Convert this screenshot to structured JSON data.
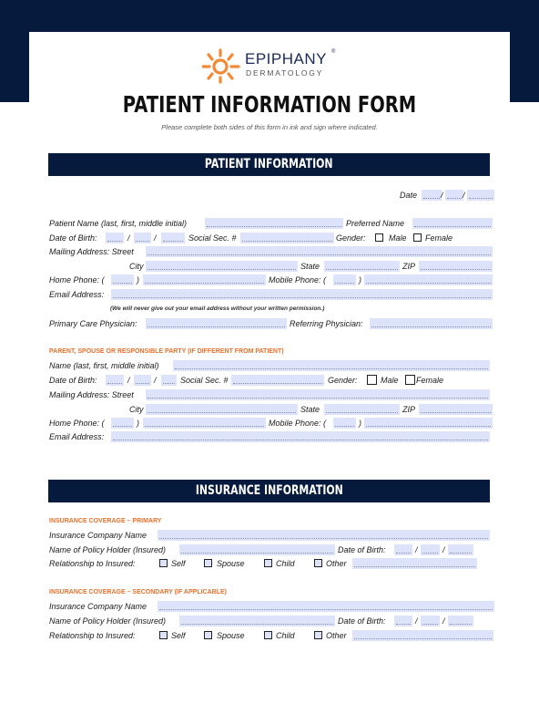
{
  "header": {
    "logo_name": "EPIPHANY",
    "logo_registered": "®",
    "logo_subtitle": "DERMATOLOGY",
    "title": "PATIENT INFORMATION FORM",
    "subtitle": "Please complete both sides of this form in ink and sign where indicated."
  },
  "colors": {
    "navy": "#061a3d",
    "accent_orange": "#e8702a",
    "field_fill": "#dde3fb"
  },
  "patient_section": {
    "title": "PATIENT INFORMATION",
    "date_label": "Date",
    "name_label": "Patient Name (last, first, middle initial)",
    "preferred_name_label": "Preferred Name",
    "dob_label": "Date of Birth:",
    "slash": "/",
    "ssn_label": "Social Sec. #",
    "gender_label": "Gender:",
    "male_label": "Male",
    "female_label": "Female",
    "street_label": "Mailing Address: Street",
    "city_label": "City",
    "state_label": "State",
    "zip_label": "ZIP",
    "home_phone_label": "Home Phone: (",
    "paren_close": ")",
    "mobile_phone_label": "Mobile Phone: (",
    "email_label": "Email Address:",
    "email_note": "(We will never give out your email address without your written permission.)",
    "pcp_label": "Primary Care Physician:",
    "referring_label": "Referring Physician:"
  },
  "responsible_party": {
    "heading": "PARENT, SPOUSE OR RESPONSIBLE PARTY (IF DIFFERENT FROM PATIENT)",
    "name_label": "Name (last, first, middle initial)",
    "dob_label": "Date of Birth:",
    "ssn_label": "Social Sec. #",
    "gender_label": "Gender:",
    "male_label": "Male",
    "female_label": "Female",
    "street_label": "Mailing Address: Street",
    "city_label": "City",
    "state_label": "State",
    "zip_label": "ZIP",
    "home_phone_label": "Home Phone: (",
    "mobile_phone_label": "Mobile Phone: (",
    "email_label": "Email Address:"
  },
  "insurance_section": {
    "title": "INSURANCE INFORMATION",
    "primary": {
      "heading": "INSURANCE COVERAGE – PRIMARY",
      "company_label": "Insurance Company Name",
      "holder_label": "Name of Policy Holder (Insured)",
      "dob_label": "Date of Birth:",
      "relationship_label": "Relationship to Insured:",
      "options": [
        "Self",
        "Spouse",
        "Child",
        "Other"
      ]
    },
    "secondary": {
      "heading": "INSURANCE COVERAGE – SECONDARY (IF APPLICABLE)",
      "company_label": "Insurance Company Name",
      "holder_label": "Name of Policy Holder (Insured)",
      "dob_label": "Date of Birth:",
      "relationship_label": "Relationship to Insured:",
      "options": [
        "Self",
        "Spouse",
        "Child",
        "Other"
      ]
    }
  }
}
